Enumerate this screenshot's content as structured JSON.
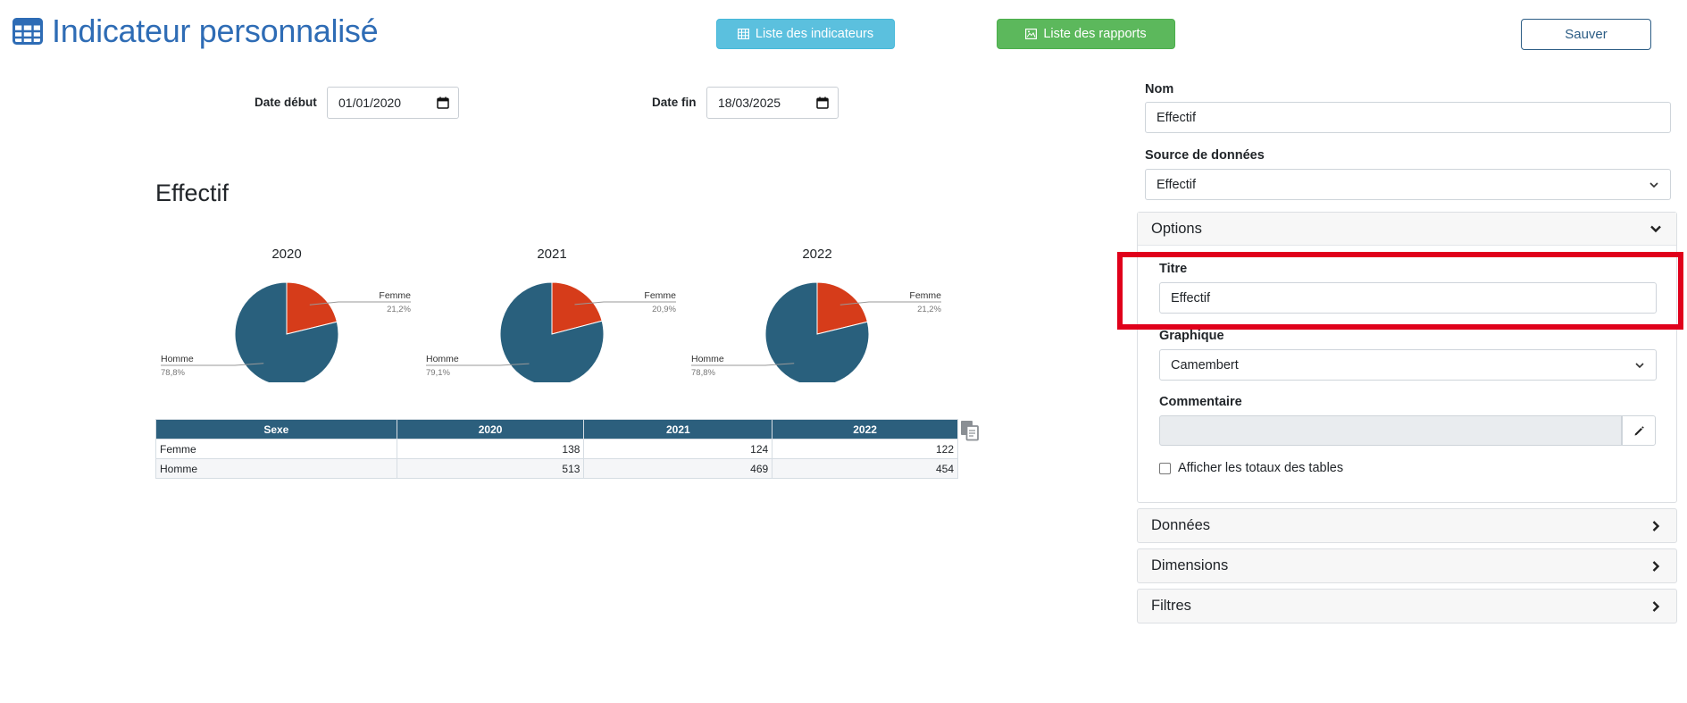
{
  "header": {
    "title": "Indicateur personnalisé",
    "icon": "table-icon"
  },
  "toolbar": {
    "list_indicators_label": "Liste des indicateurs",
    "list_reports_label": "Liste des rapports",
    "save_label": "Sauver"
  },
  "filters": {
    "start_label": "Date début",
    "start_value": "01/01/2020",
    "end_label": "Date fin",
    "end_value": "18/03/2025"
  },
  "report": {
    "title": "Effectif"
  },
  "chart_data": {
    "type": "pie",
    "charts": [
      {
        "title": "2020",
        "slices": [
          {
            "name": "Femme",
            "value": 21.2,
            "label": "21,2%"
          },
          {
            "name": "Homme",
            "value": 78.8,
            "label": "78,8%"
          }
        ]
      },
      {
        "title": "2021",
        "slices": [
          {
            "name": "Femme",
            "value": 20.9,
            "label": "20,9%"
          },
          {
            "name": "Homme",
            "value": 79.1,
            "label": "79,1%"
          }
        ]
      },
      {
        "title": "2022",
        "slices": [
          {
            "name": "Femme",
            "value": 21.2,
            "label": "21,2%"
          },
          {
            "name": "Homme",
            "value": 78.8,
            "label": "78,8%"
          }
        ]
      }
    ],
    "colors": {
      "Femme": "#d63c1a",
      "Homme": "#29607d"
    }
  },
  "table": {
    "headers": [
      "Sexe",
      "2020",
      "2021",
      "2022"
    ],
    "rows": [
      [
        "Femme",
        "138",
        "124",
        "122"
      ],
      [
        "Homme",
        "513",
        "469",
        "454"
      ]
    ]
  },
  "form": {
    "name_label": "Nom",
    "name_value": "Effectif",
    "source_label": "Source de données",
    "source_value": "Effectif",
    "options_header": "Options",
    "titre_label": "Titre",
    "titre_value": "Effectif",
    "graph_label": "Graphique",
    "graph_value": "Camembert",
    "comment_label": "Commentaire",
    "totals_label": "Afficher les totaux des tables"
  },
  "sections": {
    "data": "Données",
    "dimensions": "Dimensions",
    "filters": "Filtres"
  },
  "colors": {
    "title_blue": "#2e6cb5",
    "info": "#5bc0de",
    "success": "#5cb85c",
    "primary_dark": "#2c5d85",
    "highlight": "#e0001b"
  }
}
